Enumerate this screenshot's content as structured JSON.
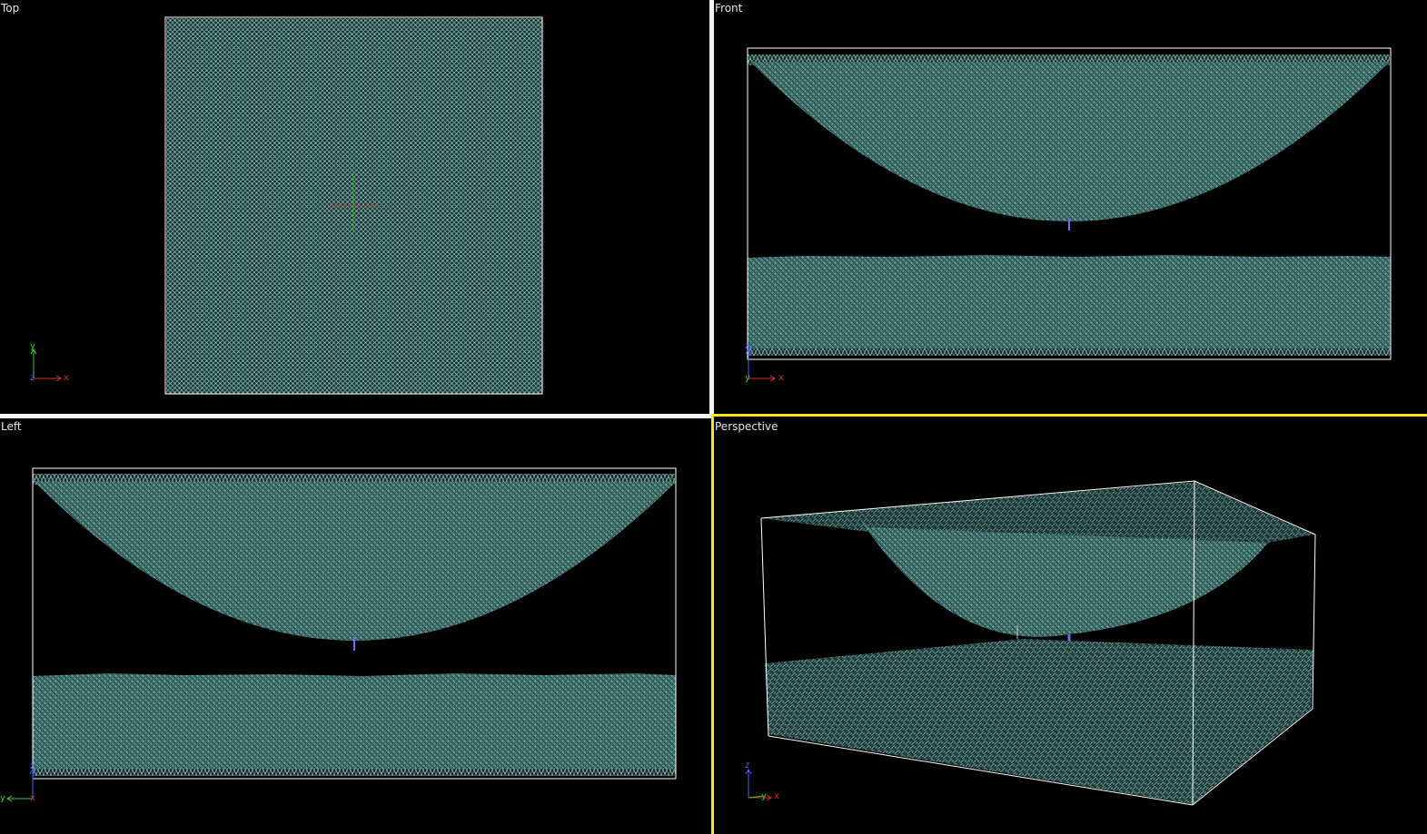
{
  "viewports": {
    "top": {
      "label": "Top"
    },
    "front": {
      "label": "Front"
    },
    "left": {
      "label": "Left"
    },
    "perspective": {
      "label": "Perspective"
    }
  },
  "axes": {
    "x": "x",
    "y": "y",
    "z": "z"
  },
  "colors": {
    "background": "#000000",
    "atoms": "#5a9b98",
    "atoms_dark": "#3e6f6d",
    "box_outline": "#ffffff",
    "divider": "#f2f2f2",
    "active_viewport_border": "#ffe600",
    "x_axis": "#e02a2a",
    "y_axis": "#2ad02a",
    "z_axis": "#4a5cff",
    "probe_marker": "#6a6aff"
  },
  "active_viewport": "perspective"
}
